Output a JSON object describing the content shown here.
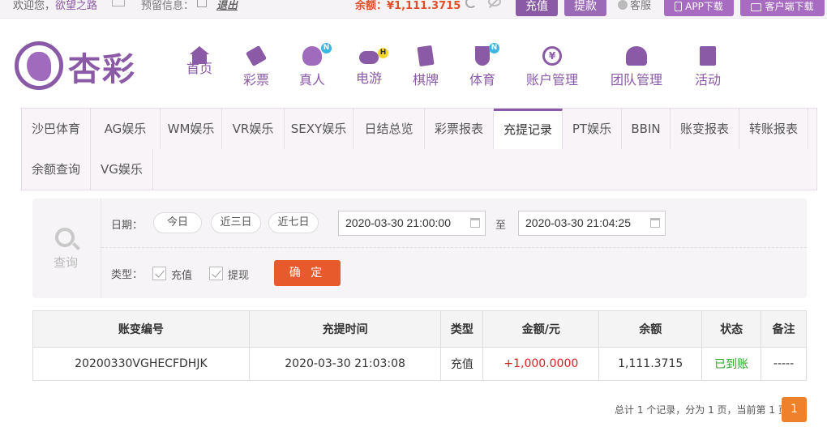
{
  "topbar": {
    "welcome": "欢迎您，",
    "username": "欲望之路",
    "reserve_label": "预留信息：",
    "logout": "退出",
    "balance_label": "余额：",
    "balance_value": "¥1,111.3715",
    "recharge": "充值",
    "withdraw": "提款",
    "service": "客服",
    "app_download": "APP下载",
    "client_download": "客户端下载"
  },
  "logo": {
    "text": "杏彩"
  },
  "nav": [
    {
      "label": "首页",
      "icon": "home-icon"
    },
    {
      "label": "彩票",
      "icon": "lottery-icon"
    },
    {
      "label": "真人",
      "icon": "live-dealer-icon",
      "badge": "N"
    },
    {
      "label": "电游",
      "icon": "gamepad-icon",
      "badge": "H"
    },
    {
      "label": "棋牌",
      "icon": "cards-icon"
    },
    {
      "label": "体育",
      "icon": "trophy-icon",
      "badge": "N"
    },
    {
      "label": "账户管理",
      "icon": "account-coin-icon"
    },
    {
      "label": "团队管理",
      "icon": "team-icon"
    },
    {
      "label": "活动",
      "icon": "gift-icon"
    }
  ],
  "tabs": [
    "沙巴体育",
    "AG娱乐",
    "WM娱乐",
    "VR娱乐",
    "SEXY娱乐",
    "日结总览",
    "彩票报表",
    "充提记录",
    "PT娱乐",
    "BBIN",
    "账变报表",
    "转账报表",
    "余额查询",
    "VG娱乐"
  ],
  "active_tab": "充提记录",
  "filter": {
    "search_label": "查询",
    "date_label": "日期：",
    "quick": [
      "今日",
      "近三日",
      "近七日"
    ],
    "start": "2020-03-30 21:00:00",
    "to": "至",
    "end": "2020-03-30 21:04:25",
    "type_label": "类型：",
    "types": [
      "充值",
      "提现"
    ],
    "confirm": "确 定"
  },
  "table": {
    "headers": [
      "账变编号",
      "充提时间",
      "类型",
      "金额/元",
      "余额",
      "状态",
      "备注"
    ],
    "rows": [
      [
        "20200330VGHECFDHJK",
        "2020-03-30 21:03:08",
        "充值",
        "+1,000.0000",
        "1,111.3715",
        "已到账",
        "-----"
      ]
    ]
  },
  "pagination": {
    "summary": "总计 1 个记录，分为 1 页，当前第 1 页",
    "current": "1"
  }
}
